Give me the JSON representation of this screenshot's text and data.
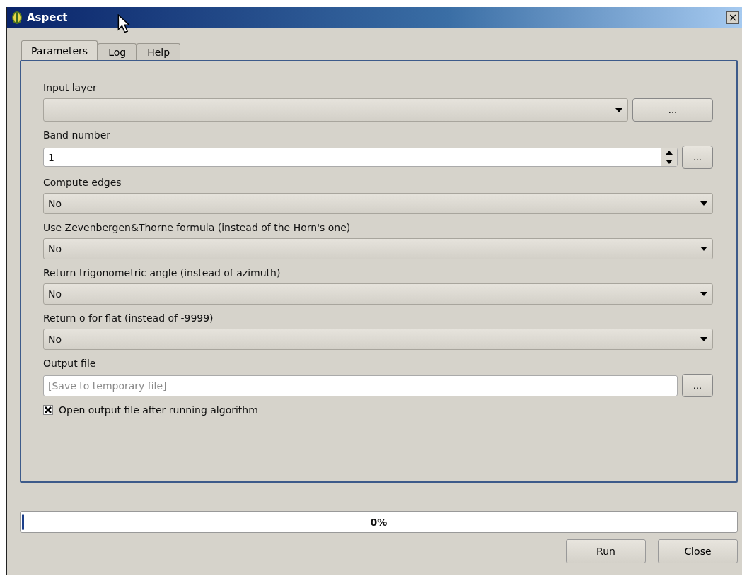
{
  "window": {
    "title": "Aspect",
    "close": "×"
  },
  "tabs": [
    {
      "label": "Parameters",
      "selected": true
    },
    {
      "label": "Log",
      "selected": false
    },
    {
      "label": "Help",
      "selected": false
    }
  ],
  "parameters": [
    {
      "kind": "combo",
      "label": "Input layer",
      "button": "..."
    },
    {
      "kind": "spin",
      "label": "Band number",
      "value": "1",
      "button": "..."
    },
    {
      "kind": "select",
      "label": "Compute edges",
      "value": "No"
    },
    {
      "kind": "select",
      "label": "Use Zevenbergen&Thorne formula (instead of the Horn's one)",
      "value": "No"
    },
    {
      "kind": "select",
      "label": "Return trigonometric angle (instead of azimuth)",
      "value": "No"
    },
    {
      "kind": "select",
      "label": "Return o for flat (instead of -9999)",
      "value": "No"
    },
    {
      "kind": "file",
      "label": "Output file",
      "placeholder": "[Save to temporary file]",
      "button": "..."
    }
  ],
  "open_output": {
    "label": "Open output file after running algorithm",
    "checked": true
  },
  "progress": {
    "level": 0,
    "reading": "0%"
  },
  "buttons": [
    "Run",
    "Close"
  ]
}
